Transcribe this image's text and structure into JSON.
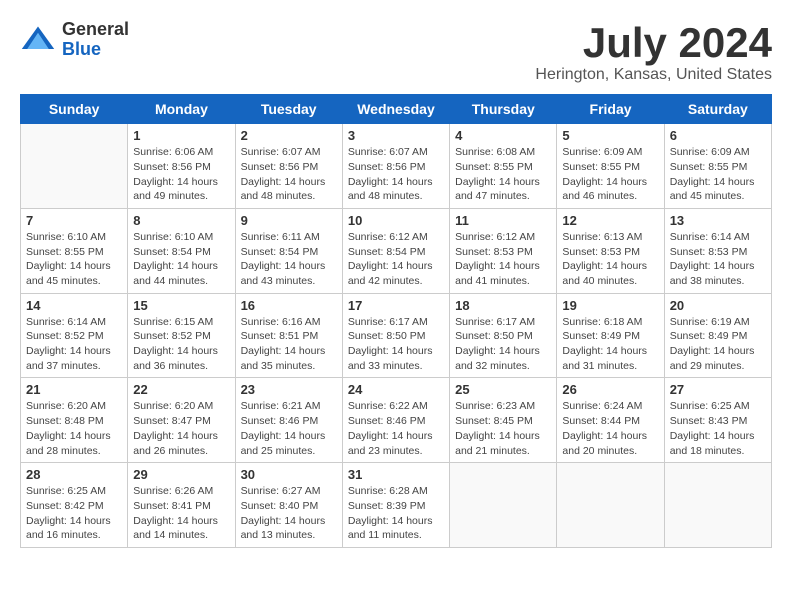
{
  "logo": {
    "general": "General",
    "blue": "Blue"
  },
  "title": "July 2024",
  "subtitle": "Herington, Kansas, United States",
  "weekdays": [
    "Sunday",
    "Monday",
    "Tuesday",
    "Wednesday",
    "Thursday",
    "Friday",
    "Saturday"
  ],
  "weeks": [
    [
      {
        "day": "",
        "sunrise": "",
        "sunset": "",
        "daylight": ""
      },
      {
        "day": "1",
        "sunrise": "Sunrise: 6:06 AM",
        "sunset": "Sunset: 8:56 PM",
        "daylight": "Daylight: 14 hours and 49 minutes."
      },
      {
        "day": "2",
        "sunrise": "Sunrise: 6:07 AM",
        "sunset": "Sunset: 8:56 PM",
        "daylight": "Daylight: 14 hours and 48 minutes."
      },
      {
        "day": "3",
        "sunrise": "Sunrise: 6:07 AM",
        "sunset": "Sunset: 8:56 PM",
        "daylight": "Daylight: 14 hours and 48 minutes."
      },
      {
        "day": "4",
        "sunrise": "Sunrise: 6:08 AM",
        "sunset": "Sunset: 8:55 PM",
        "daylight": "Daylight: 14 hours and 47 minutes."
      },
      {
        "day": "5",
        "sunrise": "Sunrise: 6:09 AM",
        "sunset": "Sunset: 8:55 PM",
        "daylight": "Daylight: 14 hours and 46 minutes."
      },
      {
        "day": "6",
        "sunrise": "Sunrise: 6:09 AM",
        "sunset": "Sunset: 8:55 PM",
        "daylight": "Daylight: 14 hours and 45 minutes."
      }
    ],
    [
      {
        "day": "7",
        "sunrise": "Sunrise: 6:10 AM",
        "sunset": "Sunset: 8:55 PM",
        "daylight": "Daylight: 14 hours and 45 minutes."
      },
      {
        "day": "8",
        "sunrise": "Sunrise: 6:10 AM",
        "sunset": "Sunset: 8:54 PM",
        "daylight": "Daylight: 14 hours and 44 minutes."
      },
      {
        "day": "9",
        "sunrise": "Sunrise: 6:11 AM",
        "sunset": "Sunset: 8:54 PM",
        "daylight": "Daylight: 14 hours and 43 minutes."
      },
      {
        "day": "10",
        "sunrise": "Sunrise: 6:12 AM",
        "sunset": "Sunset: 8:54 PM",
        "daylight": "Daylight: 14 hours and 42 minutes."
      },
      {
        "day": "11",
        "sunrise": "Sunrise: 6:12 AM",
        "sunset": "Sunset: 8:53 PM",
        "daylight": "Daylight: 14 hours and 41 minutes."
      },
      {
        "day": "12",
        "sunrise": "Sunrise: 6:13 AM",
        "sunset": "Sunset: 8:53 PM",
        "daylight": "Daylight: 14 hours and 40 minutes."
      },
      {
        "day": "13",
        "sunrise": "Sunrise: 6:14 AM",
        "sunset": "Sunset: 8:53 PM",
        "daylight": "Daylight: 14 hours and 38 minutes."
      }
    ],
    [
      {
        "day": "14",
        "sunrise": "Sunrise: 6:14 AM",
        "sunset": "Sunset: 8:52 PM",
        "daylight": "Daylight: 14 hours and 37 minutes."
      },
      {
        "day": "15",
        "sunrise": "Sunrise: 6:15 AM",
        "sunset": "Sunset: 8:52 PM",
        "daylight": "Daylight: 14 hours and 36 minutes."
      },
      {
        "day": "16",
        "sunrise": "Sunrise: 6:16 AM",
        "sunset": "Sunset: 8:51 PM",
        "daylight": "Daylight: 14 hours and 35 minutes."
      },
      {
        "day": "17",
        "sunrise": "Sunrise: 6:17 AM",
        "sunset": "Sunset: 8:50 PM",
        "daylight": "Daylight: 14 hours and 33 minutes."
      },
      {
        "day": "18",
        "sunrise": "Sunrise: 6:17 AM",
        "sunset": "Sunset: 8:50 PM",
        "daylight": "Daylight: 14 hours and 32 minutes."
      },
      {
        "day": "19",
        "sunrise": "Sunrise: 6:18 AM",
        "sunset": "Sunset: 8:49 PM",
        "daylight": "Daylight: 14 hours and 31 minutes."
      },
      {
        "day": "20",
        "sunrise": "Sunrise: 6:19 AM",
        "sunset": "Sunset: 8:49 PM",
        "daylight": "Daylight: 14 hours and 29 minutes."
      }
    ],
    [
      {
        "day": "21",
        "sunrise": "Sunrise: 6:20 AM",
        "sunset": "Sunset: 8:48 PM",
        "daylight": "Daylight: 14 hours and 28 minutes."
      },
      {
        "day": "22",
        "sunrise": "Sunrise: 6:20 AM",
        "sunset": "Sunset: 8:47 PM",
        "daylight": "Daylight: 14 hours and 26 minutes."
      },
      {
        "day": "23",
        "sunrise": "Sunrise: 6:21 AM",
        "sunset": "Sunset: 8:46 PM",
        "daylight": "Daylight: 14 hours and 25 minutes."
      },
      {
        "day": "24",
        "sunrise": "Sunrise: 6:22 AM",
        "sunset": "Sunset: 8:46 PM",
        "daylight": "Daylight: 14 hours and 23 minutes."
      },
      {
        "day": "25",
        "sunrise": "Sunrise: 6:23 AM",
        "sunset": "Sunset: 8:45 PM",
        "daylight": "Daylight: 14 hours and 21 minutes."
      },
      {
        "day": "26",
        "sunrise": "Sunrise: 6:24 AM",
        "sunset": "Sunset: 8:44 PM",
        "daylight": "Daylight: 14 hours and 20 minutes."
      },
      {
        "day": "27",
        "sunrise": "Sunrise: 6:25 AM",
        "sunset": "Sunset: 8:43 PM",
        "daylight": "Daylight: 14 hours and 18 minutes."
      }
    ],
    [
      {
        "day": "28",
        "sunrise": "Sunrise: 6:25 AM",
        "sunset": "Sunset: 8:42 PM",
        "daylight": "Daylight: 14 hours and 16 minutes."
      },
      {
        "day": "29",
        "sunrise": "Sunrise: 6:26 AM",
        "sunset": "Sunset: 8:41 PM",
        "daylight": "Daylight: 14 hours and 14 minutes."
      },
      {
        "day": "30",
        "sunrise": "Sunrise: 6:27 AM",
        "sunset": "Sunset: 8:40 PM",
        "daylight": "Daylight: 14 hours and 13 minutes."
      },
      {
        "day": "31",
        "sunrise": "Sunrise: 6:28 AM",
        "sunset": "Sunset: 8:39 PM",
        "daylight": "Daylight: 14 hours and 11 minutes."
      },
      {
        "day": "",
        "sunrise": "",
        "sunset": "",
        "daylight": ""
      },
      {
        "day": "",
        "sunrise": "",
        "sunset": "",
        "daylight": ""
      },
      {
        "day": "",
        "sunrise": "",
        "sunset": "",
        "daylight": ""
      }
    ]
  ]
}
